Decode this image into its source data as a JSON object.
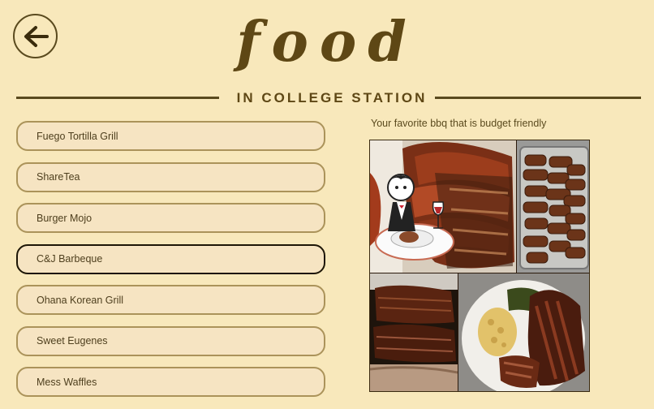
{
  "header": {
    "title": "food",
    "subtitle": "IN COLLEGE STATION",
    "back_icon": "arrow-left-icon"
  },
  "restaurants": [
    {
      "name": "Fuego Tortilla Grill",
      "selected": false
    },
    {
      "name": "ShareTea",
      "selected": false
    },
    {
      "name": "Burger Mojo",
      "selected": false
    },
    {
      "name": "C&J Barbeque",
      "selected": true
    },
    {
      "name": "Ohana Korean Grill",
      "selected": false
    },
    {
      "name": "Sweet Eugenes",
      "selected": false
    },
    {
      "name": "Mess Waffles",
      "selected": false
    }
  ],
  "detail": {
    "caption": "Your favorite bbq that is budget friendly",
    "image_icon": "restaurant-cartoon-icon"
  },
  "colors": {
    "background": "#f8e8bb",
    "accent": "#5e4715",
    "item_fill": "#f6e4c2",
    "item_border": "#ab935a",
    "selected_border": "#1d1606"
  }
}
